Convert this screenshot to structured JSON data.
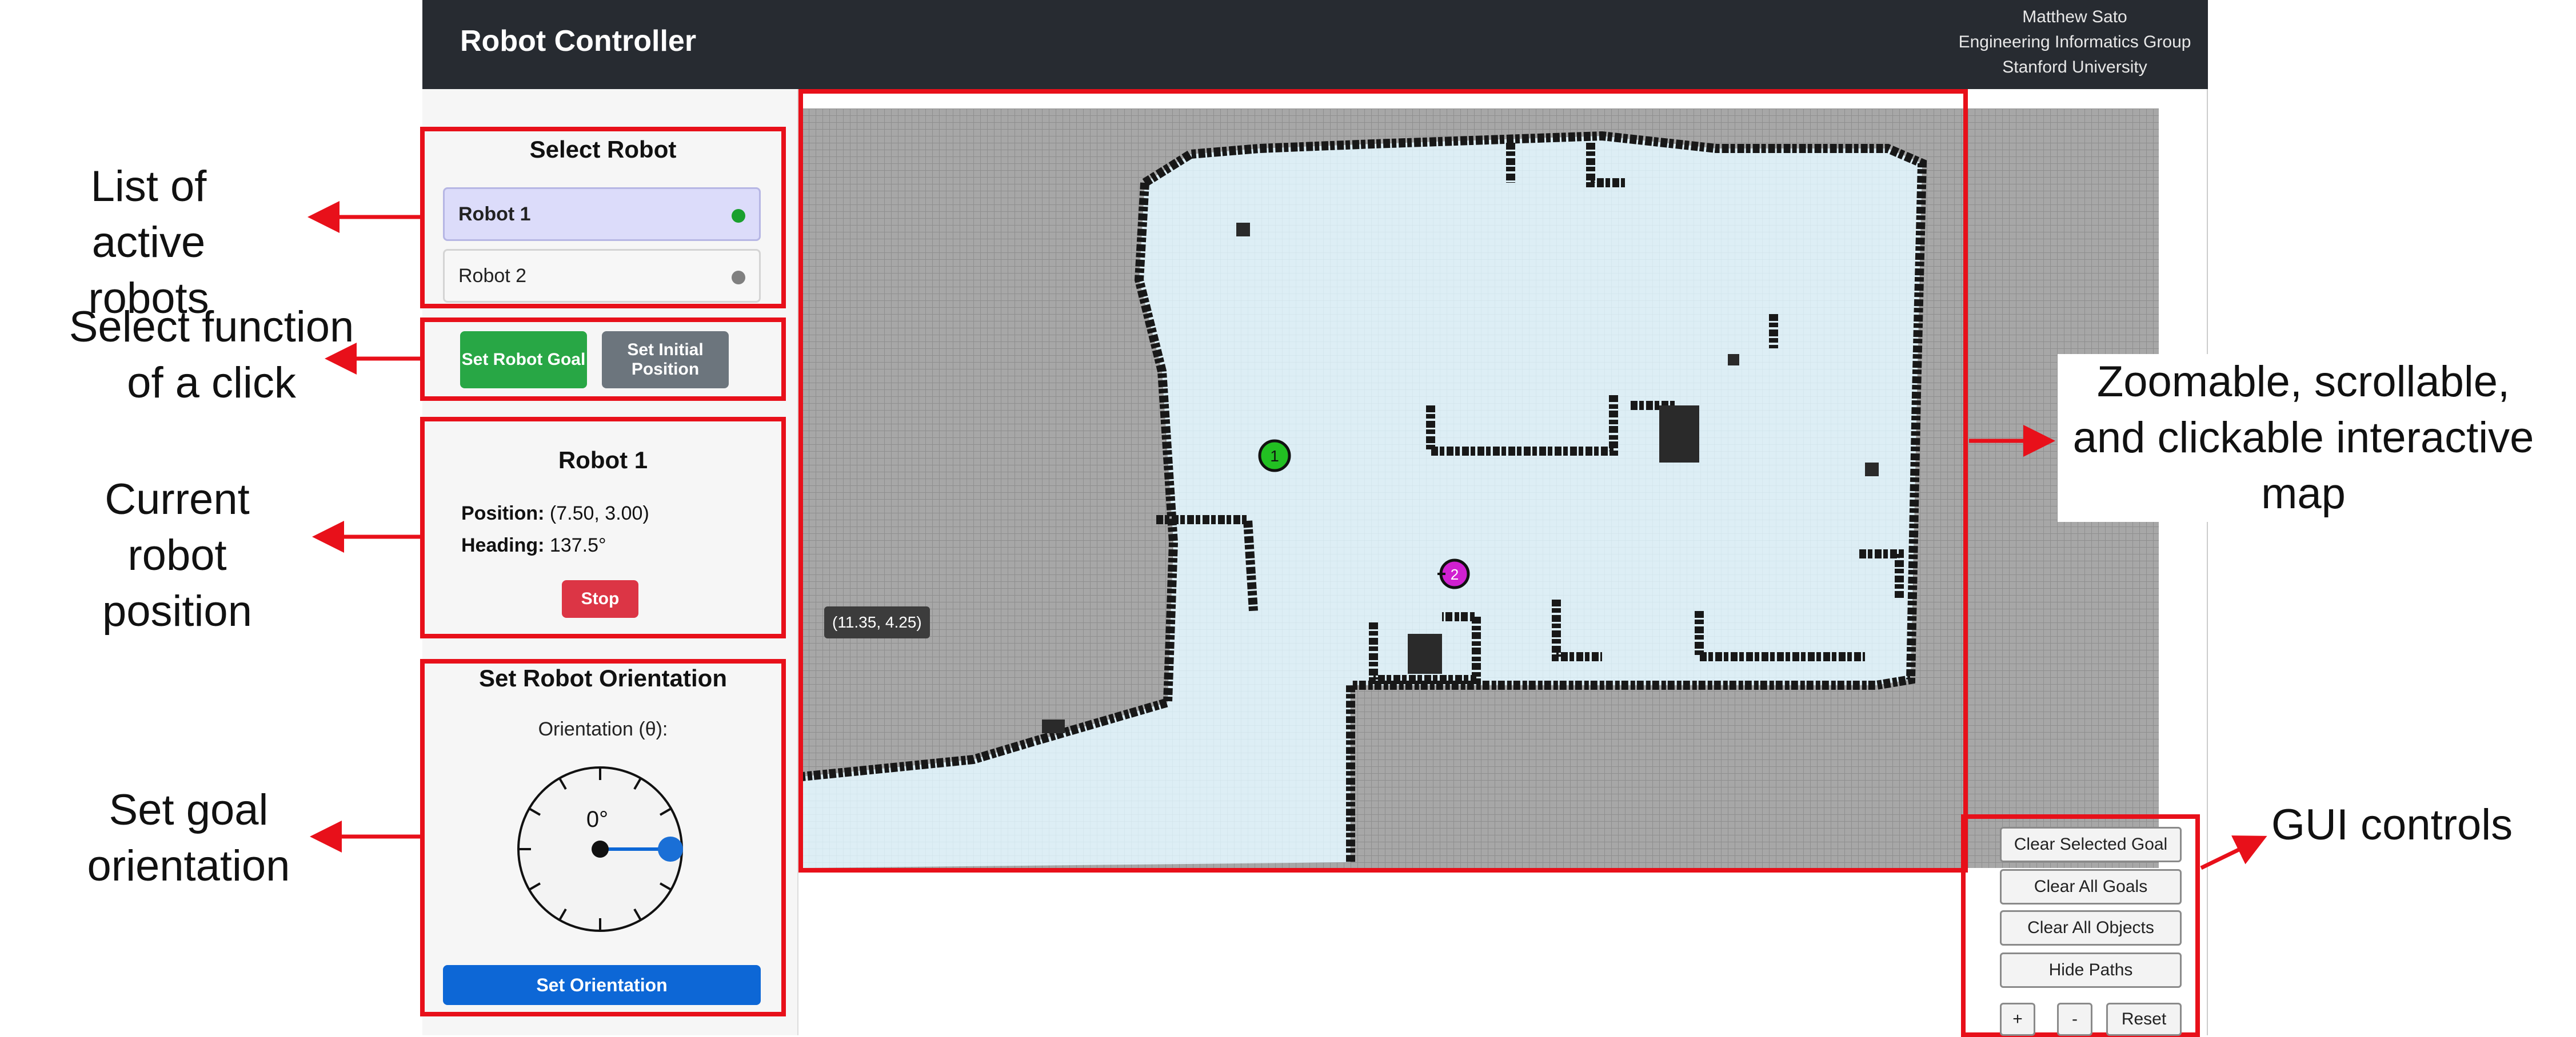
{
  "header": {
    "title": "Robot Controller",
    "user_lines": [
      "Matthew Sato",
      "Engineering Informatics Group",
      "Stanford University"
    ]
  },
  "robot_list": {
    "title": "Select Robot",
    "items": [
      {
        "label": "Robot 1",
        "status_color": "#1aa02e",
        "selected": true
      },
      {
        "label": "Robot 2",
        "status_color": "#808080",
        "selected": false
      }
    ]
  },
  "click_mode": {
    "goal_button": "Set Robot Goal",
    "initial_button": "Set Initial Position",
    "goal_color": "#28a745",
    "initial_color": "#6c757d"
  },
  "robot_info": {
    "title": "Robot 1",
    "position_label": "Position:",
    "position_value": "(7.50, 3.00)",
    "heading_label": "Heading:",
    "heading_value": "137.5°",
    "stop_button": "Stop",
    "stop_color": "#dc3545"
  },
  "orientation": {
    "title": "Set Robot Orientation",
    "label": "Orientation (θ):",
    "dial_value": "0°",
    "set_button": "Set Orientation",
    "button_color": "#0d67d6"
  },
  "map": {
    "coord_tooltip": "(11.35, 4.25)",
    "robots": [
      {
        "label": "1",
        "color": "#22c022"
      },
      {
        "label": "2",
        "color": "#d020d0"
      }
    ]
  },
  "controls": {
    "buttons": [
      "Clear Selected Goal",
      "Clear All Goals",
      "Clear All Objects",
      "Hide Paths"
    ],
    "zoom_in": "+",
    "zoom_out": "-",
    "reset": "Reset"
  },
  "annotations": {
    "robot_list": "List of active robots",
    "click_function": "Select function of a click",
    "robot_position": "Current robot position",
    "goal_orientation": "Set goal orientation",
    "map": "Zoomable, scrollable, and clickable interactive map",
    "gui_controls": "GUI controls"
  },
  "highlight_color": "#e8101a"
}
